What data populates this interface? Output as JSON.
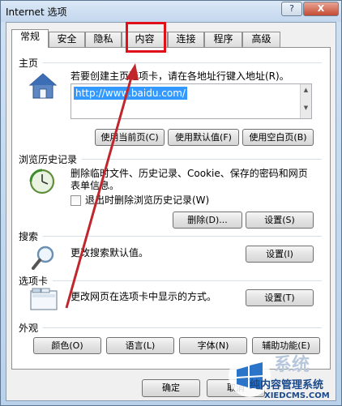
{
  "window": {
    "title": "Internet 选项",
    "help_label": "?",
    "close_label": "X"
  },
  "tabs": [
    {
      "label": "常规",
      "active": true
    },
    {
      "label": "安全"
    },
    {
      "label": "隐私"
    },
    {
      "label": "内容"
    },
    {
      "label": "连接"
    },
    {
      "label": "程序"
    },
    {
      "label": "高级"
    }
  ],
  "homepage": {
    "title": "主页",
    "description": "若要创建主页选项卡，请在各地址行键入地址(R)。",
    "url": "http://www.baidu.com/",
    "btn_current": "使用当前页(C)",
    "btn_default": "使用默认值(F)",
    "btn_blank": "使用空白页(B)"
  },
  "history": {
    "title": "浏览历史记录",
    "description_line1": "删除临时文件、历史记录、Cookie、保存的密码和网页",
    "description_line2": "表单信息。",
    "checkbox_label": "退出时删除浏览历史记录(W)",
    "checkbox_checked": false,
    "btn_delete": "删除(D)...",
    "btn_settings": "设置(S)"
  },
  "search": {
    "title": "搜索",
    "description": "更改搜索默认值。",
    "btn_settings": "设置(I)"
  },
  "tabs_section": {
    "title": "选项卡",
    "description": "更改网页在选项卡中显示的方式。",
    "btn_settings": "设置(T)"
  },
  "appearance": {
    "title": "外观",
    "btn_colors": "颜色(O)",
    "btn_languages": "语言(L)",
    "btn_fonts": "字体(N)",
    "btn_accessibility": "辅助功能(E)"
  },
  "dialog": {
    "ok_label": "确定",
    "cancel_label": "取消"
  },
  "annotation": {
    "highlight_color": "#e0101a",
    "arrow_color": "#c0262c",
    "highlighted_tab": "内容"
  },
  "watermark": {
    "line1": "系统",
    "line2": "纯内容管理系统",
    "url": "XIEDCMS.COM"
  }
}
